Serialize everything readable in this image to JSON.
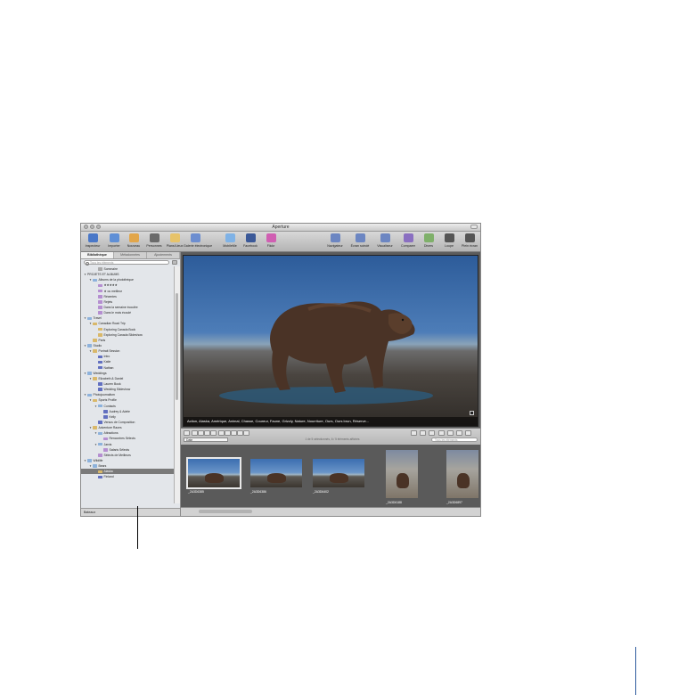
{
  "window": {
    "title": "Aperture"
  },
  "toolbar": {
    "items": [
      {
        "label": "Inspecteur",
        "color": "#4a78c8"
      },
      {
        "label": "Importer",
        "color": "#5f8fd6"
      },
      {
        "label": "Nouveau",
        "color": "#e2a64a"
      },
      {
        "label": "Personnes",
        "color": "#6b6b6b"
      },
      {
        "label": "Plans/Lieux",
        "color": "#e7c36a"
      },
      {
        "label": "Galerie électronique",
        "color": "#6d8ed0"
      },
      {
        "label": "MobileMe",
        "color": "#7fb2e6"
      },
      {
        "label": "Facebook",
        "color": "#3b5998"
      },
      {
        "label": "Flickr",
        "color": "#d05fb2"
      },
      {
        "label": "Navigateur",
        "color": "#6c86c2"
      },
      {
        "label": "Écran scindé",
        "color": "#6c86c2"
      },
      {
        "label": "Visualiseur",
        "color": "#6c86c2"
      },
      {
        "label": "Comparer",
        "color": "#8a6fc1"
      },
      {
        "label": "Divers",
        "color": "#7fb06a"
      },
      {
        "label": "Loupe",
        "color": "#555555"
      },
      {
        "label": "Plein écran",
        "color": "#555555"
      }
    ]
  },
  "sidebar": {
    "tabs": [
      {
        "label": "Bibliothèque",
        "active": true
      },
      {
        "label": "Métadonnées",
        "active": false
      },
      {
        "label": "Ajustements",
        "active": false
      }
    ],
    "search_placeholder": "Tous les éléments",
    "tree": [
      {
        "label": "Sommaire",
        "indent": 2,
        "icon": "library",
        "tri": ""
      },
      {
        "label": "PROJETS ET ALBUMS",
        "indent": 0,
        "icon": "none",
        "tri": "▼"
      },
      {
        "label": "Albums de la photothèque",
        "indent": 1,
        "icon": "folder",
        "tri": "▼"
      },
      {
        "label": "★★★★★",
        "indent": 2,
        "icon": "smart",
        "tri": ""
      },
      {
        "label": "★ ou meilleur",
        "indent": 2,
        "icon": "smart",
        "tri": ""
      },
      {
        "label": "Récentes",
        "indent": 2,
        "icon": "smart",
        "tri": ""
      },
      {
        "label": "Rejets",
        "indent": 2,
        "icon": "smart",
        "tri": ""
      },
      {
        "label": "Dans la semaine écoulée",
        "indent": 2,
        "icon": "smart",
        "tri": ""
      },
      {
        "label": "Dans le mois écoulé",
        "indent": 2,
        "icon": "smart",
        "tri": ""
      },
      {
        "label": "Travel",
        "indent": 0,
        "icon": "folder",
        "tri": "▼"
      },
      {
        "label": "Canadian Road Trip",
        "indent": 1,
        "icon": "project",
        "tri": "▼"
      },
      {
        "label": "Exploring Canada Book",
        "indent": 2,
        "icon": "project",
        "tri": ""
      },
      {
        "label": "Exploring Canada Slideshow",
        "indent": 2,
        "icon": "project",
        "tri": ""
      },
      {
        "label": "Paris",
        "indent": 1,
        "icon": "project",
        "tri": ""
      },
      {
        "label": "Studio",
        "indent": 0,
        "icon": "folder",
        "tri": "▼"
      },
      {
        "label": "Portrait Session",
        "indent": 1,
        "icon": "project",
        "tri": "▼"
      },
      {
        "label": "Intro",
        "indent": 2,
        "icon": "album",
        "tri": ""
      },
      {
        "label": "Katie",
        "indent": 2,
        "icon": "album",
        "tri": ""
      },
      {
        "label": "Nathan",
        "indent": 2,
        "icon": "album",
        "tri": ""
      },
      {
        "label": "Weddings",
        "indent": 0,
        "icon": "folder",
        "tri": "▼"
      },
      {
        "label": "Elizabeth & Daniel",
        "indent": 1,
        "icon": "project",
        "tri": "▼"
      },
      {
        "label": "Lauren Book",
        "indent": 2,
        "icon": "album",
        "tri": ""
      },
      {
        "label": "Wedding Slideshow",
        "indent": 2,
        "icon": "album",
        "tri": ""
      },
      {
        "label": "Photojournalism",
        "indent": 0,
        "icon": "folder",
        "tri": "▼"
      },
      {
        "label": "Sports Profile",
        "indent": 1,
        "icon": "project",
        "tri": "▼"
      },
      {
        "label": "Contacts",
        "indent": 2,
        "icon": "folder",
        "tri": "▼"
      },
      {
        "label": "Audrey & Adele",
        "indent": 3,
        "icon": "album",
        "tri": ""
      },
      {
        "label": "Kelly",
        "indent": 3,
        "icon": "album",
        "tri": ""
      },
      {
        "label": "Versus de Composition",
        "indent": 2,
        "icon": "album",
        "tri": ""
      },
      {
        "label": "Adventure Races",
        "indent": 1,
        "icon": "project",
        "tri": "▼"
      },
      {
        "label": "Attractions",
        "indent": 2,
        "icon": "folder",
        "tri": "▼"
      },
      {
        "label": "Rencontres Sélects",
        "indent": 3,
        "icon": "smart",
        "tri": ""
      },
      {
        "label": "Jarvis",
        "indent": 2,
        "icon": "folder",
        "tri": "▼"
      },
      {
        "label": "Safaris Sélects",
        "indent": 3,
        "icon": "smart",
        "tri": ""
      },
      {
        "label": "Sélects de Meilleurs",
        "indent": 2,
        "icon": "smart",
        "tri": ""
      },
      {
        "label": "Wildlife",
        "indent": 0,
        "icon": "folder",
        "tri": "▼"
      },
      {
        "label": "Bears",
        "indent": 1,
        "icon": "folder",
        "tri": "▼"
      },
      {
        "label": "Alaska",
        "indent": 2,
        "icon": "project",
        "tri": "",
        "selected": true
      },
      {
        "label": "Finland",
        "indent": 2,
        "icon": "album",
        "tri": ""
      }
    ],
    "footer_label": "Bateaux"
  },
  "viewer": {
    "caption": "Action, Alaska, Amérique, Animal, Chasse, Coureur, Faune, Grizzly, Nature, Nourriture, Ours, Ours brun, Réserve..."
  },
  "browser": {
    "sort_label": "Date",
    "center_text": "1 de 5 sélectionnés, 6 / 5 éléments affichés",
    "search_placeholder": "Tous les éléments"
  },
  "filmstrip": {
    "thumbs": [
      {
        "name": "Alaska",
        "label": "_2A3D6385",
        "kind": "land",
        "selected": true
      },
      {
        "name": "Alaska",
        "label": "_2A3D6386",
        "kind": "land",
        "selected": false
      },
      {
        "name": "Alaska",
        "label": "_2A3D6402",
        "kind": "land",
        "selected": false
      },
      {
        "name": "Alaska",
        "label": "_2A3D6188",
        "kind": "port",
        "selected": false
      },
      {
        "name": "Alaska",
        "label": "_2A3D6897",
        "kind": "port",
        "selected": false
      }
    ]
  }
}
